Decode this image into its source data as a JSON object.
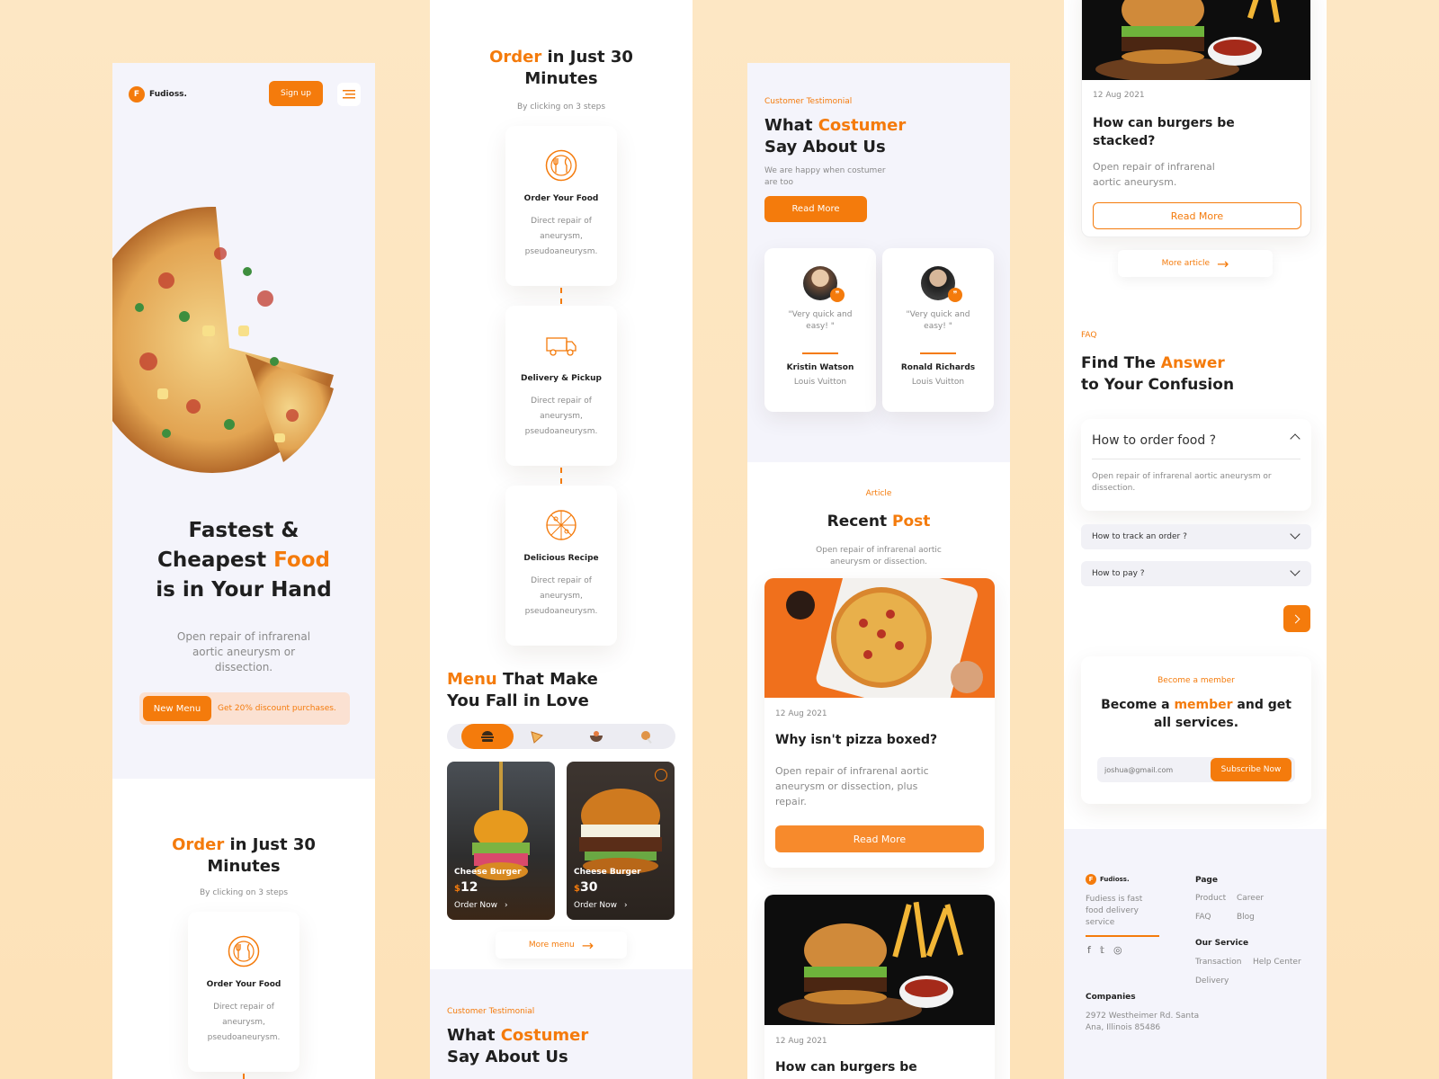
{
  "brand": {
    "name": "Fudioss.",
    "initial": "F"
  },
  "header": {
    "signup": "Sign up"
  },
  "hero": {
    "line1": "Fastest &",
    "line2a": "Cheapest ",
    "line2b": "Food",
    "line3": "is in Your Hand",
    "desc": "Open repair of infrarenal aortic aneurysm or dissection.",
    "new_menu": "New Menu",
    "discount": "Get 20% discount purchases."
  },
  "order": {
    "title_a": "Order",
    "title_b": " in Just 30",
    "title_c": "Minutes",
    "sub": "By clicking on 3 steps"
  },
  "steps": [
    {
      "title": "Order Your Food",
      "desc": "Direct repair of aneurysm, pseudoaneurysm.",
      "icon": "cutlery-icon"
    },
    {
      "title": "Delivery & Pickup",
      "desc": "Direct repair of aneurysm, pseudoaneurysm.",
      "icon": "truck-icon"
    },
    {
      "title": "Delicious Recipe",
      "desc": "Direct repair of aneurysm, pseudoaneurysm.",
      "icon": "pizza-icon"
    }
  ],
  "menu": {
    "title_a": "Menu",
    "title_b": " That Make",
    "title_c": "You Fall in Love",
    "more": "More menu",
    "items": [
      {
        "name": "Cheese Burger",
        "currency": "$",
        "price": "12",
        "cta": "Order Now"
      },
      {
        "name": "Cheese Burger",
        "currency": "$",
        "price": "30",
        "cta": "Order Now"
      }
    ]
  },
  "testimonial": {
    "eyebrow": "Customer Testimonial",
    "title_a": "What ",
    "title_b": "Costumer",
    "title_c": "Say About Us",
    "desc": "We are happy when costumer are too",
    "read_more": "Read More",
    "people": [
      {
        "quote": "\"Very quick and easy! \"",
        "name": "Kristin Watson",
        "company": "Louis Vuitton"
      },
      {
        "quote": "\"Very quick and easy! \"",
        "name": "Ronald Richards",
        "company": "Louis Vuitton"
      }
    ]
  },
  "article": {
    "eyebrow": "Article",
    "title_a": "Recent ",
    "title_b": "Post",
    "desc": "Open repair of infrarenal aortic aneurysm or dissection.",
    "posts": [
      {
        "date": "12 Aug 2021",
        "title": "Why isn't pizza boxed?",
        "desc": "Open repair of infrarenal aortic aneurysm or dissection, plus repair.",
        "cta": "Read More"
      },
      {
        "date": "12 Aug 2021",
        "title": "How can burgers be",
        "title_full": "How can burgers be stacked?",
        "desc": "Open repair of infrarenal aortic aneurysm.",
        "cta": "Read More"
      }
    ],
    "more": "More article"
  },
  "faq": {
    "eyebrow": "FAQ",
    "title_a": "Find The ",
    "title_b": "Answer",
    "title_c": "to Your Confusion",
    "items": [
      {
        "q": "How to order food ?",
        "a": "Open repair of infrarenal aortic aneurysm or dissection."
      },
      {
        "q": "How to track an order ?"
      },
      {
        "q": "How to pay ?"
      }
    ]
  },
  "member": {
    "eyebrow": "Become a member",
    "title_a": "Become a ",
    "title_b": "member",
    "title_c": " and get",
    "title_d": "all services.",
    "placeholder": "joshua@gmail.com",
    "cta": "Subscribe Now"
  },
  "footer": {
    "tagline": "Fudiess is fast food delivery service",
    "page_h": "Page",
    "page": [
      "Product",
      "Career",
      "FAQ",
      "Blog"
    ],
    "service_h": "Our Service",
    "service": [
      "Transaction",
      "Help Center",
      "Delivery"
    ],
    "companies_h": "Companies",
    "address": "2972 Westheimer Rd. Santa Ana, Illinois 85486"
  },
  "colors": {
    "accent": "#f47b0c",
    "bg": "#fde5bf",
    "soft": "#f4f4fb"
  }
}
